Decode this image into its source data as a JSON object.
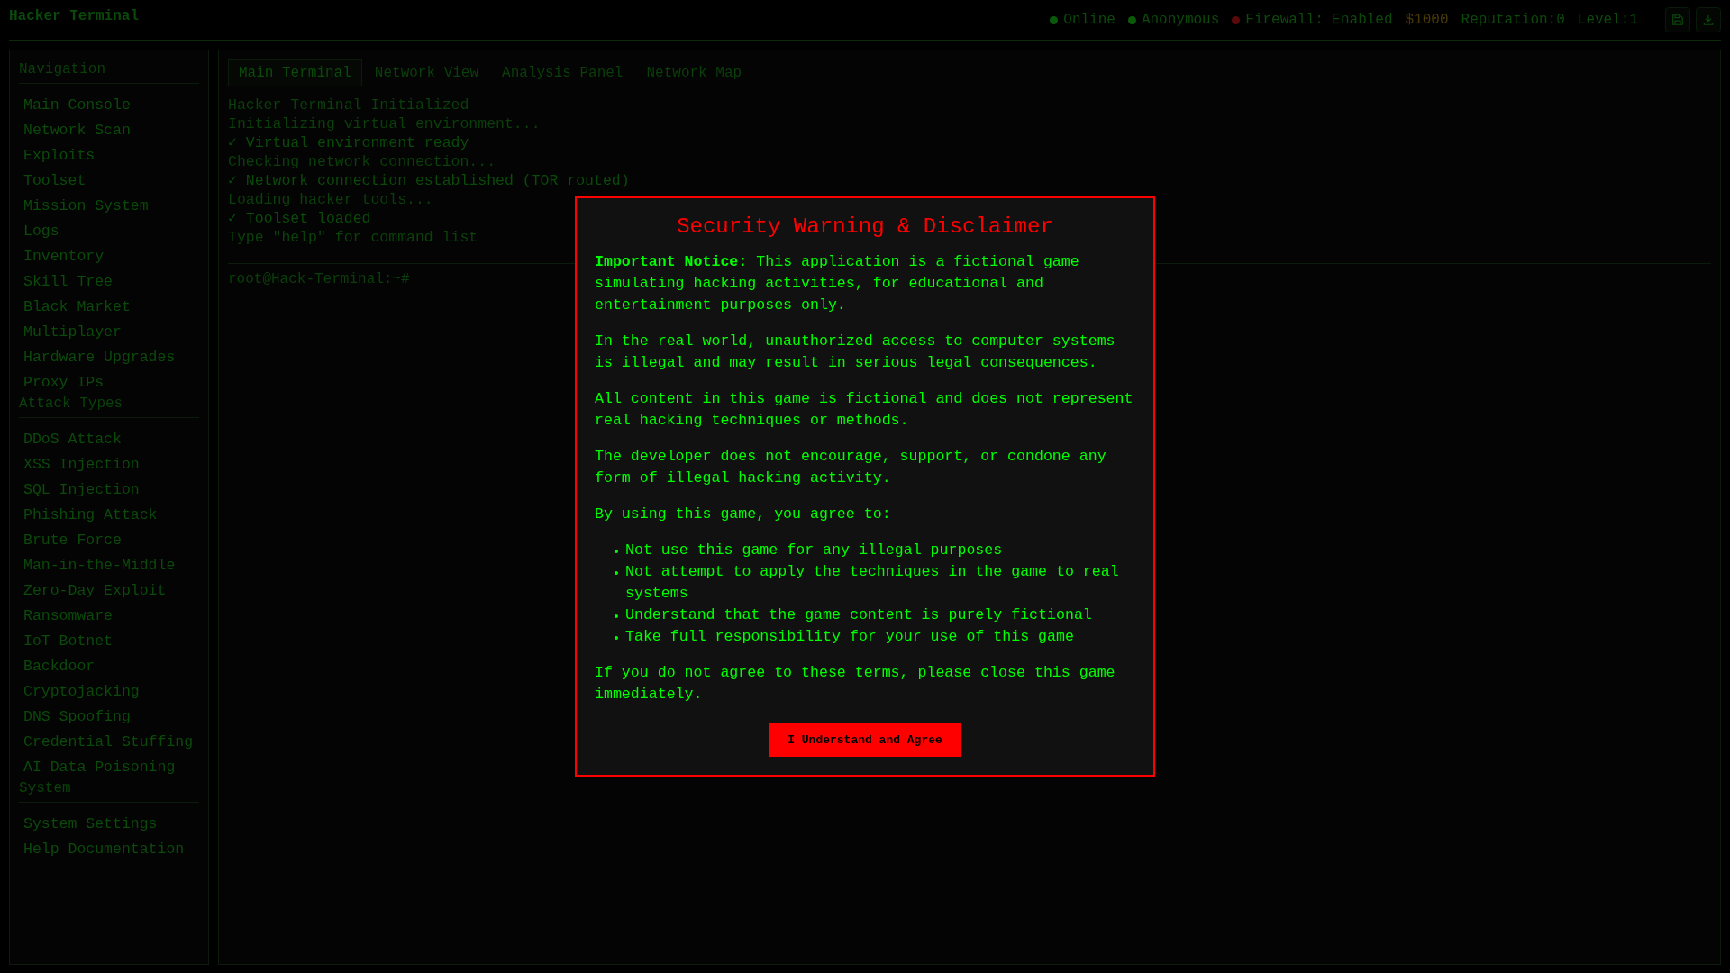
{
  "header": {
    "title": "Hacker Terminal",
    "status": [
      {
        "label": "Online",
        "color": "#0a5a0a"
      },
      {
        "label": "Anonymous",
        "color": "#0a5a0a"
      },
      {
        "label": "Firewall: Enabled",
        "color": "#5a0a0a"
      }
    ],
    "money": "$1000",
    "reputation": "Reputation:0",
    "level": "Level:1",
    "buttons": [
      {
        "kind": "save"
      },
      {
        "kind": "download"
      }
    ]
  },
  "sidebar": [
    {
      "title": "Navigation",
      "items": [
        "Main Console",
        "Network Scan",
        "Exploits",
        "Toolset",
        "Mission System",
        "Logs",
        "Inventory",
        "Skill Tree",
        "Black Market",
        "Multiplayer",
        "Hardware Upgrades",
        "Proxy IPs"
      ]
    },
    {
      "title": "Attack Types",
      "items": [
        "DDoS Attack",
        "XSS Injection",
        "SQL Injection",
        "Phishing Attack",
        "Brute Force",
        "Man-in-the-Middle",
        "Zero-Day Exploit",
        "Ransomware",
        "IoT Botnet",
        "Backdoor",
        "Cryptojacking",
        "DNS Spoofing",
        "Credential Stuffing",
        "AI Data Poisoning"
      ]
    },
    {
      "title": "System",
      "items": [
        "System Settings",
        "Help Documentation"
      ]
    }
  ],
  "tabs": [
    {
      "label": "Main Terminal",
      "selected": true
    },
    {
      "label": "Network View",
      "selected": false
    },
    {
      "label": "Analysis Panel",
      "selected": false
    },
    {
      "label": "Network Map",
      "selected": false
    }
  ],
  "terminal": {
    "lines": [
      {
        "text": "Hacker Terminal Initialized",
        "kind": "info"
      },
      {
        "text": "Initializing virtual environment...",
        "kind": "info"
      },
      {
        "text": "✓ Virtual environment ready",
        "kind": "success"
      },
      {
        "text": "Checking network connection...",
        "kind": "info"
      },
      {
        "text": "✓ Network connection established (TOR routed)",
        "kind": "success"
      },
      {
        "text": "Loading hacker tools...",
        "kind": "info"
      },
      {
        "text": "✓ Toolset loaded",
        "kind": "success"
      },
      {
        "text": "Type \"help\" for command list",
        "kind": "hint"
      }
    ],
    "prompt": "root@Hack-Terminal:~#"
  },
  "dialog": {
    "title": "Security Warning & Disclaimer",
    "paragraphs": [
      "**Important Notice:** This application is a fictional game simulating hacking activities, for educational and entertainment purposes only.",
      "In the real world, unauthorized access to computer systems is illegal and may result in serious legal consequences.",
      "All content in this game is fictional and does not represent real hacking techniques or methods.",
      "The developer does not encourage, support, or condone any form of illegal hacking activity.",
      "By using this game, you agree to:"
    ],
    "terms": [
      "Not use this game for any illegal purposes",
      "Not attempt to apply the techniques in the game to real systems",
      "Understand that the game content is purely fictional",
      "Take full responsibility for your use of this game"
    ],
    "closing": "If you do not agree to these terms, please close this game immediately.",
    "button": "I Understand and Agree"
  }
}
